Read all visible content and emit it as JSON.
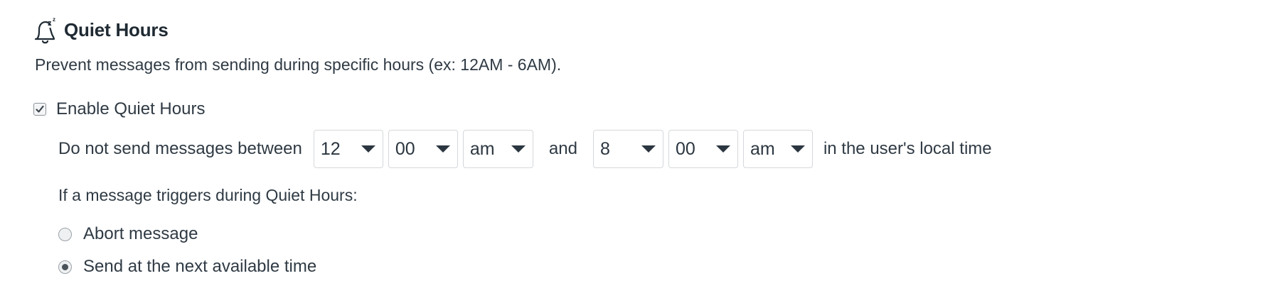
{
  "section": {
    "title": "Quiet Hours",
    "icon": "bell-snooze-icon",
    "description": "Prevent messages from sending during specific hours (ex: 12AM - 6AM)."
  },
  "enable": {
    "label": "Enable Quiet Hours",
    "checked": true
  },
  "schedule": {
    "prefix": "Do not send messages between",
    "start": {
      "hour": "12",
      "minute": "00",
      "period": "am"
    },
    "and_label": "and",
    "end": {
      "hour": "8",
      "minute": "00",
      "period": "am"
    },
    "suffix": "in the user's local time"
  },
  "trigger": {
    "question": "If a message triggers during Quiet Hours:",
    "options": [
      {
        "label": "Abort message",
        "selected": false
      },
      {
        "label": "Send at the next available time",
        "selected": true
      }
    ]
  }
}
